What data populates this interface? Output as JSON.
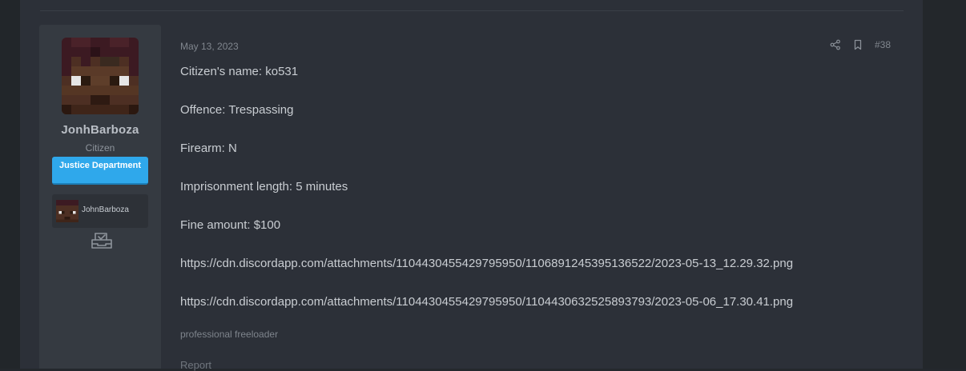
{
  "user": {
    "name": "JonhBarboza",
    "title": "Citizen",
    "banner": "Justice Department",
    "linked_account_name": "JohnBarboza"
  },
  "post": {
    "date": "May 13, 2023",
    "number": "#38",
    "lines": [
      "Citizen's name: ko531",
      "Offence: Trespassing",
      "Firearm: N",
      "Imprisonment length: 5 minutes",
      "Fine amount: $100",
      "https://cdn.discordapp.com/attachments/1104430455429795950/1106891245395136522/2023-05-13_12.29.32.png",
      "https://cdn.discordapp.com/attachments/1104430455429795950/1104430632525893793/2023-05-06_17.30.41.png"
    ],
    "signature": "professional freeloader",
    "report_label": "Report"
  },
  "icons": {
    "share": "share-icon",
    "bookmark": "bookmark-icon",
    "ticket": "ticket-icon"
  },
  "colors": {
    "banner_bg": "#2fa8eb",
    "panel_bg": "#2c3038",
    "user_column_bg": "#353a41"
  }
}
